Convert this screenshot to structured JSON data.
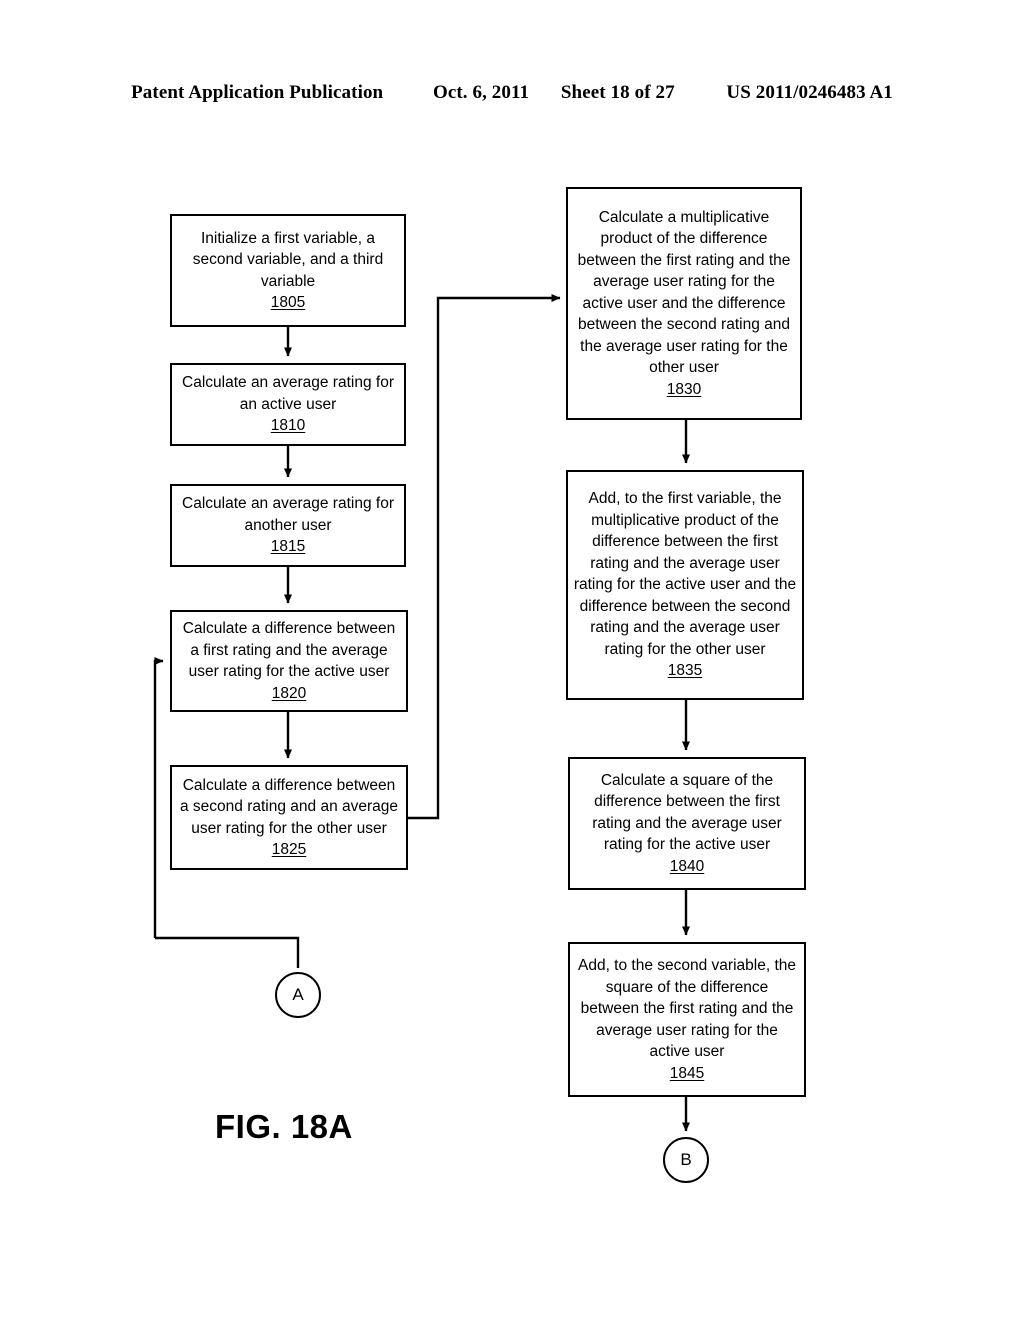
{
  "header": {
    "publication": "Patent Application Publication",
    "date": "Oct. 6, 2011",
    "sheet": "Sheet 18 of 27",
    "patent_number": "US 2011/0246483 A1"
  },
  "figure": {
    "caption": "FIG. 18A"
  },
  "flowchart": {
    "boxes": [
      {
        "id": "1805",
        "text": "Initialize a first variable, a second variable, and a third variable",
        "ref": "1805"
      },
      {
        "id": "1810",
        "text": "Calculate an average rating for an active user",
        "ref": "1810"
      },
      {
        "id": "1815",
        "text": "Calculate an average rating for another user",
        "ref": "1815"
      },
      {
        "id": "1820",
        "text": "Calculate a difference between a first rating and the average user rating for the active user",
        "ref": "1820"
      },
      {
        "id": "1825",
        "text": "Calculate a difference between a second rating and an average user rating for the other user",
        "ref": "1825"
      },
      {
        "id": "1830",
        "text": "Calculate a multiplicative product of the difference between the first rating and the average user rating for the active user and the difference between the second rating and the average user rating for the other user",
        "ref": "1830"
      },
      {
        "id": "1835",
        "text": "Add, to the first variable, the multiplicative product of the difference between the first rating and the average user rating for the active user and the difference between the second rating and the average user rating for the other user",
        "ref": "1835"
      },
      {
        "id": "1840",
        "text": "Calculate a square of the difference between the first rating and the average user rating for the active user",
        "ref": "1840"
      },
      {
        "id": "1845",
        "text": "Add, to the second variable, the square of the difference between the first rating and the average user rating for the active user",
        "ref": "1845"
      }
    ],
    "connectors": [
      {
        "id": "A",
        "label": "A"
      },
      {
        "id": "B",
        "label": "B"
      }
    ]
  },
  "colors": {
    "ink": "#000000",
    "paper": "#ffffff"
  }
}
